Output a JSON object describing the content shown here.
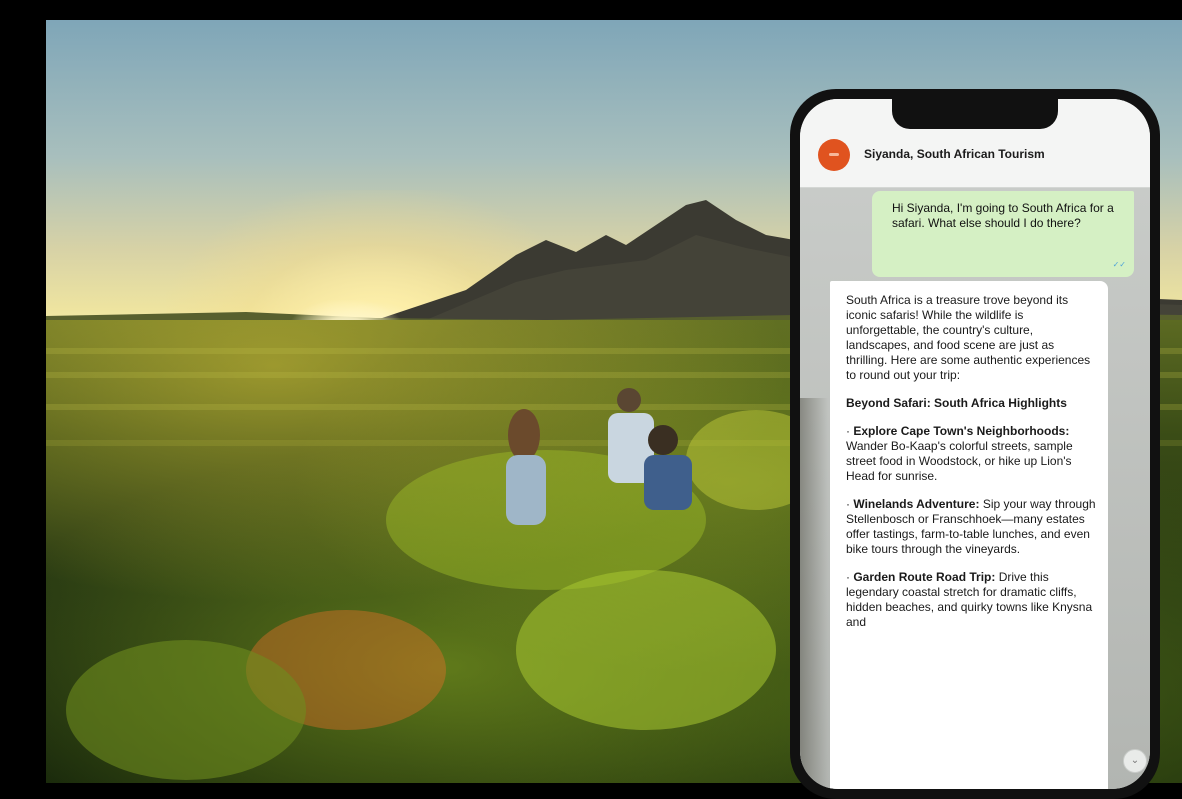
{
  "chat": {
    "contact_name": "Siyanda, South African Tourism",
    "outgoing_message": "Hi Siyanda, I'm going to South Africa for a safari. What else should I do there?",
    "incoming": {
      "intro": "South Africa is a treasure trove beyond its iconic safaris! While the wildlife is unforgettable, the country's culture, landscapes, and food scene are just as thrilling. Here are some authentic experiences to round out your trip:",
      "heading": "Beyond Safari: South Africa Highlights",
      "items": [
        {
          "title": "Explore Cape Town's Neighborhoods:",
          "text": "Wander Bo-Kaap's colorful streets, sample street food in Woodstock, or hike up Lion's Head for sunrise."
        },
        {
          "title": "Winelands Adventure:",
          "text": "Sip your way through Stellenbosch or Franschhoek—many estates offer tastings, farm-to-table lunches, and even bike tours through the vineyards."
        },
        {
          "title": "Garden Route Road Trip:",
          "text": "Drive this legendary coastal stretch for dramatic cliffs, hidden beaches, and quirky towns like Knysna and"
        }
      ]
    }
  },
  "colors": {
    "avatar": "#e0531f",
    "outgoing_bubble": "#d5f0c4",
    "incoming_bubble": "#ffffff"
  },
  "icons": {
    "read_receipt": "double-check-icon",
    "scroll": "scroll-down-icon"
  }
}
